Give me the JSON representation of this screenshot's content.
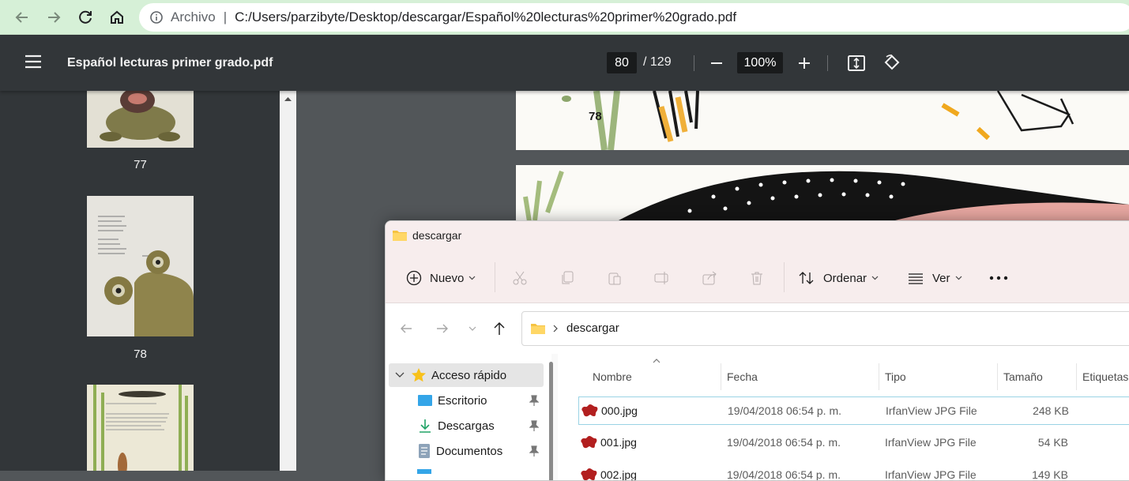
{
  "browser": {
    "scheme_label": "Archivo",
    "url": "C:/Users/parzibyte/Desktop/descargar/Español%20lecturas%20primer%20grado.pdf"
  },
  "pdf_viewer": {
    "title": "Español lecturas primer grado.pdf",
    "current_page": "80",
    "total_pages": "/ 129",
    "zoom": "100%",
    "thumbnails": [
      {
        "label": "77"
      },
      {
        "label": "78"
      }
    ],
    "page_number_visible": "78"
  },
  "explorer": {
    "title": "descargar",
    "commands": {
      "new_label": "Nuevo",
      "sort_label": "Ordenar",
      "view_label": "Ver"
    },
    "breadcrumb": "descargar",
    "nav_items": [
      {
        "label": "Acceso rápido"
      },
      {
        "label": "Escritorio"
      },
      {
        "label": "Descargas"
      },
      {
        "label": "Documentos"
      }
    ],
    "columns": [
      "Nombre",
      "Fecha",
      "Tipo",
      "Tamaño",
      "Etiquetas"
    ],
    "files": [
      {
        "name": "000.jpg",
        "date": "19/04/2018 06:54 p. m.",
        "type": "IrfanView JPG File",
        "size": "248 KB"
      },
      {
        "name": "001.jpg",
        "date": "19/04/2018 06:54 p. m.",
        "type": "IrfanView JPG File",
        "size": "54 KB"
      },
      {
        "name": "002.jpg",
        "date": "19/04/2018 06:54 p. m.",
        "type": "IrfanView JPG File",
        "size": "149 KB"
      }
    ]
  },
  "colors": {
    "browser_bar": "#d6f0d7",
    "pdf_toolbar": "#323639",
    "explorer_title": "#f7eded",
    "selection_border": "#9ad3e5"
  }
}
